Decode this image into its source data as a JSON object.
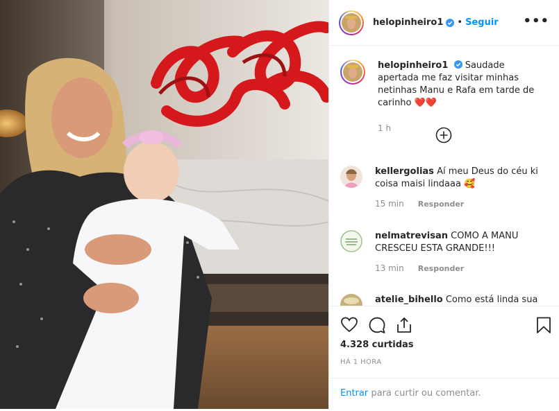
{
  "post": {
    "username": "helopinheiro1",
    "separator": "•",
    "follow_label": "Seguir",
    "more_label": "•••",
    "caption": "Saudade apertada me faz visitar minhas netinhas Manu e Rafa em tarde de carinho",
    "caption_emoji": "❤️❤️",
    "caption_time": "1 h",
    "load_more_icon": "plus-circle-icon"
  },
  "comments": [
    {
      "username": "kellergolias",
      "text": "Aí meu Deus do céu ki coisa maisi lindaaa",
      "emoji": "🥰",
      "time": "15 min",
      "reply": "Responder"
    },
    {
      "username": "nelmatrevisan",
      "text": "COMO A MANU CRESCEU ESTA GRANDE!!!",
      "emoji": "",
      "time": "13 min",
      "reply": "Responder"
    },
    {
      "username": "atelie_bihello",
      "text": "Como está linda sua",
      "emoji": "",
      "time": "",
      "reply": ""
    }
  ],
  "actions": {
    "icons": [
      "heart-icon",
      "comment-icon",
      "share-icon",
      "bookmark-icon"
    ],
    "likes": "4.328 curtidas",
    "posted": "HÁ 1 HORA"
  },
  "login": {
    "link": "Entrar",
    "text": " para curtir ou comentar."
  },
  "colors": {
    "accent": "#0095f6",
    "heart": "#ed4956",
    "muted": "#8e8e8e",
    "text": "#262626"
  }
}
